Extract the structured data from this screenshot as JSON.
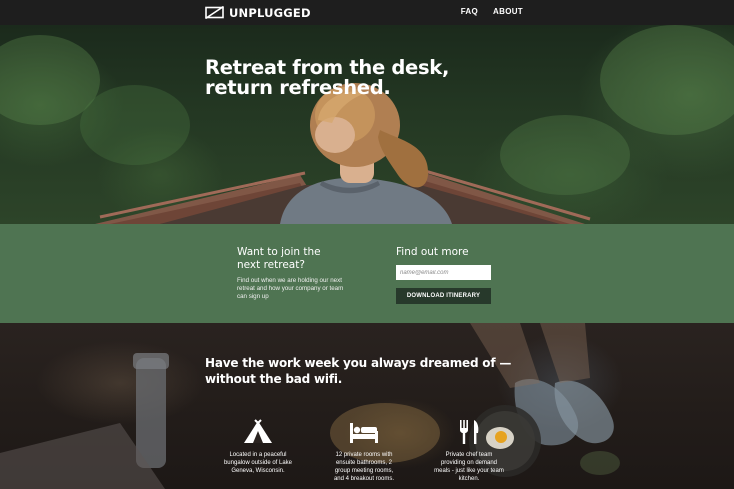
{
  "nav": {
    "brand": "UNPLUGGED",
    "links": [
      "FAQ",
      "ABOUT"
    ]
  },
  "hero": {
    "title_line1": "Retreat from the desk,",
    "title_line2": "return refreshed."
  },
  "signup": {
    "join_heading_line1": "Want to join the",
    "join_heading_line2": "next retreat?",
    "join_text": "Find out when we are holding our next retreat and how your company or team can sign up",
    "find_heading": "Find out more",
    "email_placeholder": "name@email.com",
    "download_label": "DOWNLOAD ITINERARY"
  },
  "features": {
    "title_line1": "Have the work week you always dreamed of —",
    "title_line2": "without the bad wifi.",
    "items": [
      {
        "icon": "tent-icon",
        "text": "Located in a peaceful bungalow outside of Lake Geneva, Wisconsin."
      },
      {
        "icon": "bed-icon",
        "text": "12 private rooms with ensuite bathrooms, 2 group meeting rooms, and 4 breakout rooms."
      },
      {
        "icon": "fork-knife-icon",
        "text": "Private chef team providing on demand meals - just like your team kitchen."
      }
    ]
  },
  "colors": {
    "nav_bg": "#1e1e1e",
    "signup_bg": "#4f7452",
    "button_bg": "#27392b"
  }
}
